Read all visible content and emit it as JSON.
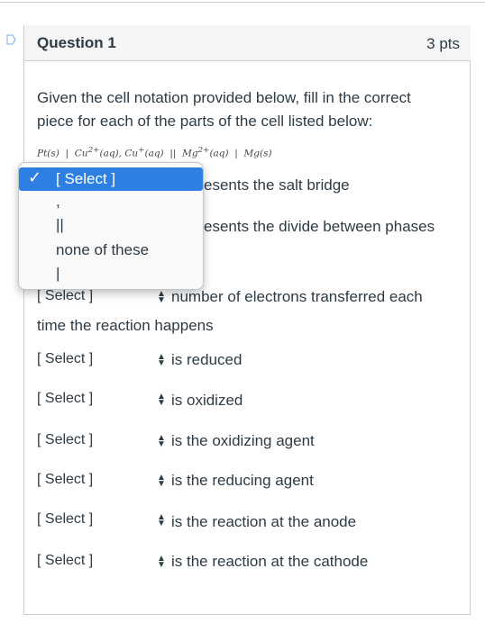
{
  "question": {
    "title": "Question 1",
    "points": "3 pts",
    "prompt": "Given the cell notation provided below, fill in the correct piece for each of the parts of the cell listed below:",
    "notation": "Pt(s) | Cu²⁺(aq), Cu⁺(aq) || Mg²⁺(aq) | Mg(s)"
  },
  "dropdown_menu": {
    "options": [
      "[ Select ]",
      ",",
      "||",
      "none of these",
      "|"
    ],
    "selected": "[ Select ]"
  },
  "items": [
    {
      "select": "[ Select ]",
      "desc": "represents the salt bridge",
      "visible_desc": "esents the salt bridge"
    },
    {
      "select": "[ Select ]",
      "desc": "represents the divide between phases",
      "visible_desc": "esents the divide between phases"
    },
    {
      "select": "[ Select ]",
      "desc": "number of electrons transferred each"
    },
    {
      "select": "[ Select ]",
      "desc": "is reduced"
    },
    {
      "select": "[ Select ]",
      "desc": "is oxidized"
    },
    {
      "select": "[ Select ]",
      "desc": "is the oxidizing agent"
    },
    {
      "select": "[ Select ]",
      "desc": "is the reducing agent"
    },
    {
      "select": "[ Select ]",
      "desc": "is the reaction at the anode"
    },
    {
      "select": "[ Select ]",
      "desc": "is the reaction at the cathode"
    }
  ],
  "wrap_text": "time the reaction happens",
  "colors": {
    "accent": "#2d80e2",
    "text": "#2d3b45",
    "border": "#c7cdd1",
    "header_bg": "#f5f5f5"
  }
}
